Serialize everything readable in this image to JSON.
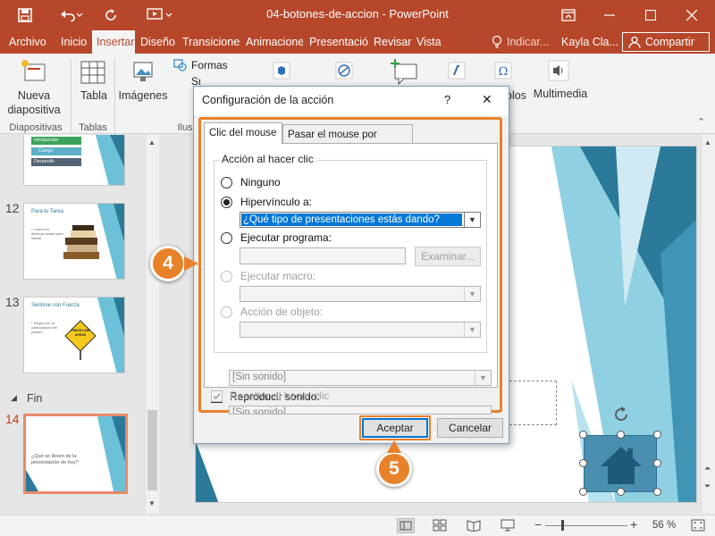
{
  "window": {
    "title": "04-botones-de-accion  -  PowerPoint"
  },
  "menu": {
    "tabs": [
      "Archivo",
      "Inicio",
      "Insertar",
      "Diseño",
      "Transiciones",
      "Animaciones",
      "Presentación",
      "Revisar",
      "Vista"
    ],
    "active": "Insertar",
    "tell_me": "Indicar...",
    "user": "Kayla Cla...",
    "share": "Compartir"
  },
  "ribbon": {
    "nueva_diapositiva": [
      "Nueva",
      "diapositiva"
    ],
    "tabla": "Tabla",
    "imagenes": "Imágenes",
    "formas": "Formas",
    "smartart": "SmartArt",
    "multimedia": "Multimedia",
    "groups": {
      "diapositivas": "Diapositivas",
      "tablas": "Tablas",
      "ilustraciones": "Ilus"
    },
    "partial_label": "olos"
  },
  "thumbnails": [
    {
      "num": "",
      "title": "",
      "rows": [
        "Introducción",
        "Cuerpo",
        "Desarrollo"
      ]
    },
    {
      "num": "12",
      "title": "Para tu Tarea",
      "text": "• Lorem fox diversus adalis para hablar"
    },
    {
      "num": "13",
      "title": "Sentirse con Fuerza",
      "text": "• Según con la colaboración del público",
      "sign": "FINISH LINE AHEAD"
    },
    {
      "num": "14",
      "title": "",
      "text": "¿Qué se lleven de la presentación de hoy?",
      "selected": true
    }
  ],
  "section": {
    "name": "Fin"
  },
  "dialog": {
    "title": "Configuración de la acción",
    "help": "?",
    "close": "✕",
    "tabs": [
      "Clic del mouse",
      "Pasar el mouse por encima"
    ],
    "active_tab": "Clic del mouse",
    "group_title": "Acción al hacer clic",
    "options": {
      "none": "Ninguno",
      "hyperlink": "Hipervínculo a:",
      "hyperlink_value": "¿Qué tipo de presentaciones estás dando?",
      "run_program": "Ejecutar programa:",
      "examine": "Examinar...",
      "run_macro": "Ejecutar macro:",
      "object_action": "Acción de objeto:"
    },
    "selected_option": "hyperlink",
    "play_sound": "Reproducir sonido:",
    "sound_value": "[Sin sonido]",
    "highlight": "Resaltar al hacer clic",
    "accept": "Aceptar",
    "cancel": "Cancelar"
  },
  "callouts": [
    "4",
    "5"
  ],
  "statusbar": {
    "zoom": "56 %",
    "minus": "−",
    "plus": "+"
  },
  "colors": {
    "brand": "#b7472a",
    "callout": "#e8822a",
    "teal": "#2b7a9a",
    "teal_light": "#6cc1d8",
    "focus": "#0078d7"
  },
  "icons": [
    "save-icon",
    "undo-icon",
    "redo-icon",
    "present-icon",
    "ribbon-display-icon",
    "minimize-icon",
    "maximize-icon",
    "close-icon",
    "lightbulb-icon",
    "person-icon",
    "home-icon",
    "rotate-icon"
  ]
}
